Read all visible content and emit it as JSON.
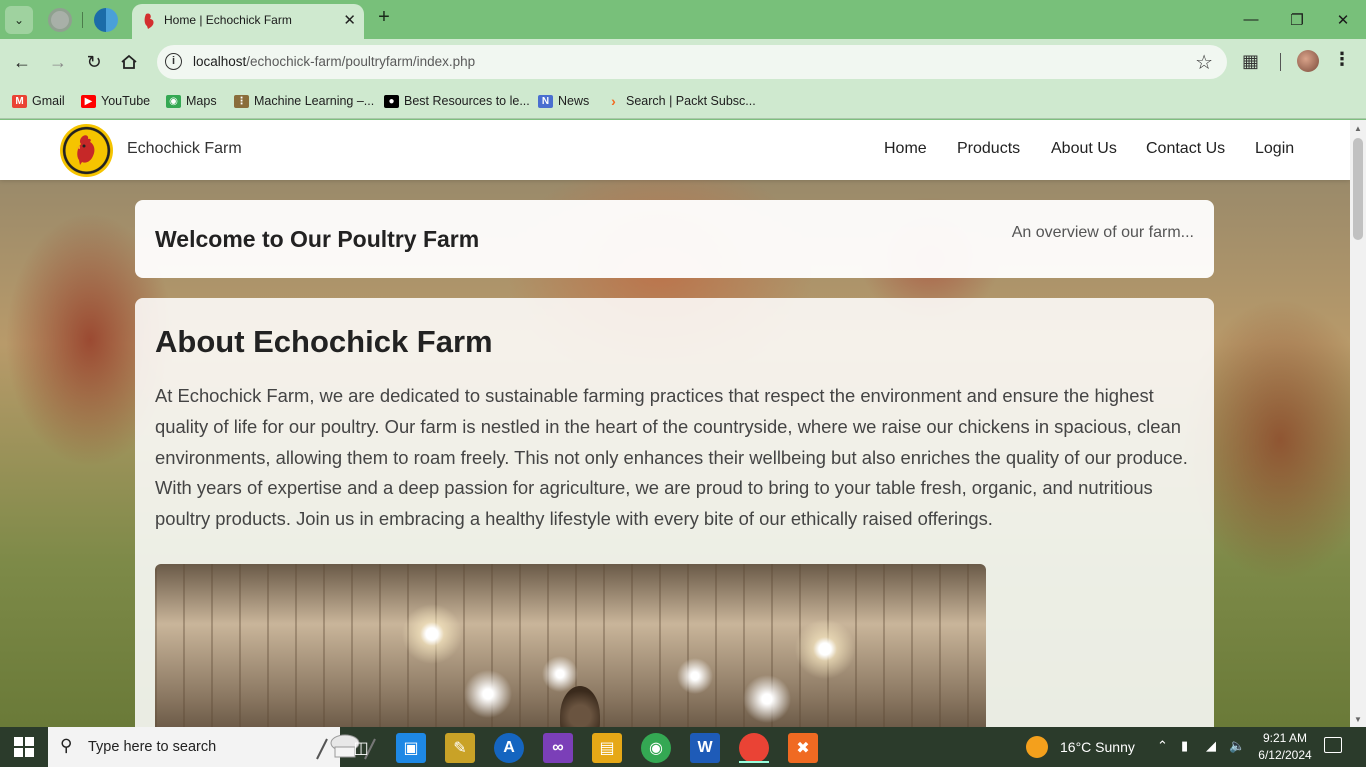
{
  "browser": {
    "tab": {
      "title": "Home | Echochick Farm"
    },
    "url": {
      "host": "localhost",
      "path": "/echochick-farm/poultryfarm/index.php"
    },
    "bookmarks": [
      {
        "label": "Gmail",
        "icon": "gmail-icon",
        "color": "#ea4335"
      },
      {
        "label": "YouTube",
        "icon": "youtube-icon",
        "color": "#ff0000"
      },
      {
        "label": "Maps",
        "icon": "maps-icon",
        "color": "#34a853"
      },
      {
        "label": "Machine Learning –...",
        "icon": "dots-icon",
        "color": "#8a6d3b"
      },
      {
        "label": "Best Resources to le...",
        "icon": "medium-icon",
        "color": "#000000"
      },
      {
        "label": "News",
        "icon": "news-icon",
        "color": "#4a6fd0"
      },
      {
        "label": "Search | Packt Subsc...",
        "icon": "packt-icon",
        "color": "#f26a21"
      }
    ]
  },
  "site": {
    "brand": "Echochick Farm",
    "nav": [
      "Home",
      "Products",
      "About Us",
      "Contact Us",
      "Login"
    ],
    "welcome": {
      "title": "Welcome to Our Poultry Farm",
      "subtitle": "An overview of our farm..."
    },
    "about": {
      "title": "About Echochick Farm",
      "paragraph1": "At Echochick Farm, we are dedicated to sustainable farming practices that respect the environment and ensure the highest quality of life for our poultry. Our farm is nestled in the heart of the countryside, where we raise our chickens in spacious, clean environments, allowing them to roam freely. This not only enhances their wellbeing but also enriches the quality of our produce.",
      "paragraph2": "With years of expertise and a deep passion for agriculture, we are proud to bring to your table fresh, organic, and nutritious poultry products. Join us in embracing a healthy lifestyle with every bite of our ethically raised offerings."
    }
  },
  "taskbar": {
    "search_placeholder": "Type here to search",
    "weather": "16°C  Sunny",
    "time": "9:21 AM",
    "date": "6/12/2024"
  }
}
